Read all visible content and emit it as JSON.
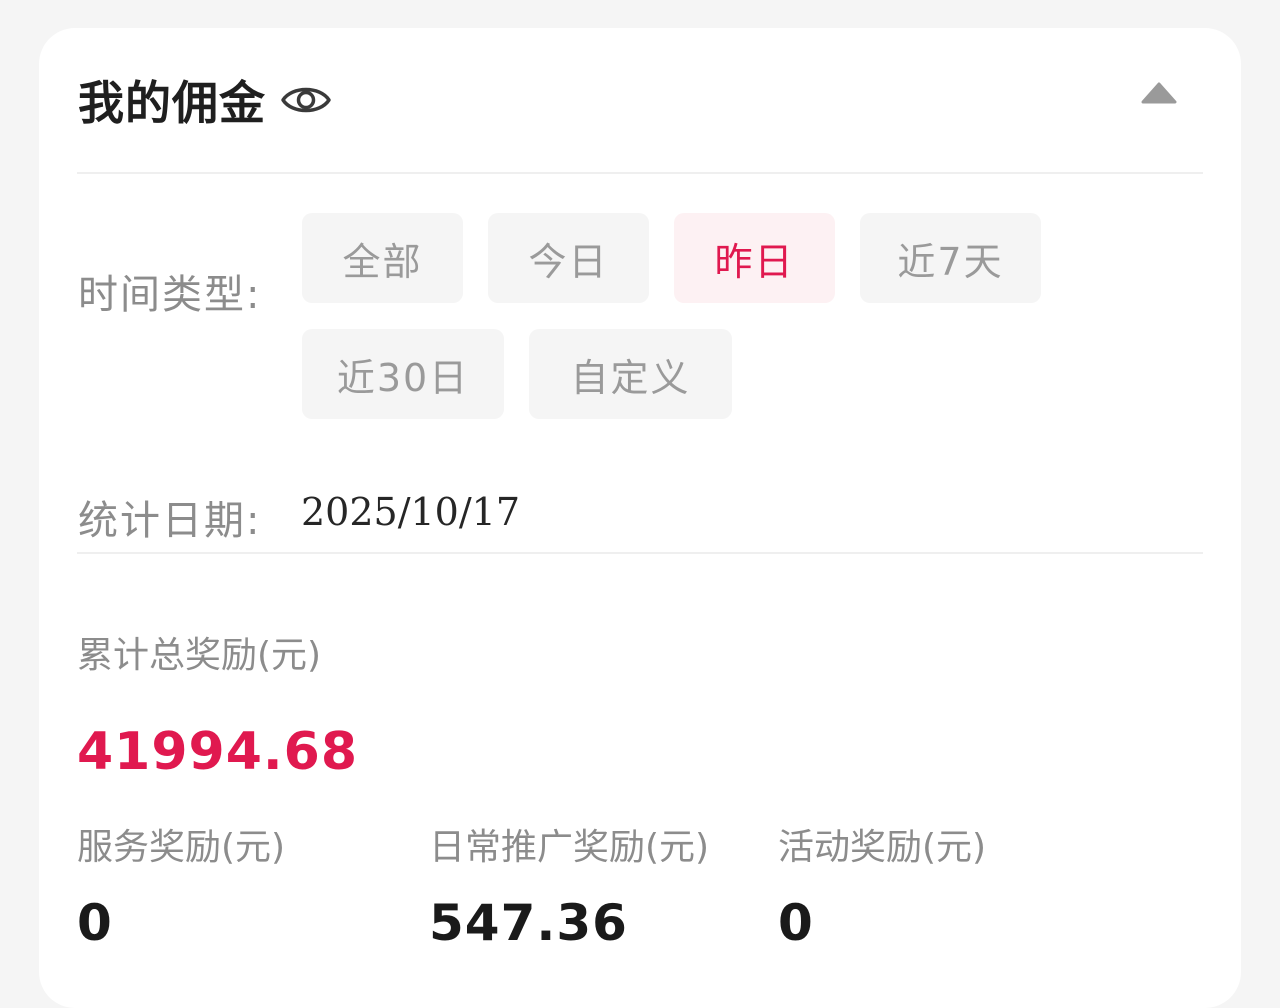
{
  "header": {
    "title": "我的佣金",
    "eye_icon": "eye-icon",
    "collapse_icon": "triangle-up-icon"
  },
  "filter": {
    "time_type_label": "时间类型:",
    "options": [
      "全部",
      "今日",
      "昨日",
      "近7天",
      "近30日",
      "自定义"
    ],
    "selected": "昨日"
  },
  "stat_date": {
    "label": "统计日期:",
    "value": "2025/10/17"
  },
  "total": {
    "label": "累计总奖励(元)",
    "value": "41994.68"
  },
  "breakdown": [
    {
      "label": "服务奖励(元)",
      "value": "0"
    },
    {
      "label": "日常推广奖励(元)",
      "value": "547.36"
    },
    {
      "label": "活动奖励(元)",
      "value": "0"
    }
  ],
  "colors": {
    "accent": "#e0194f",
    "active_bg": "#fdf1f3",
    "muted_text": "#8c8c8c",
    "button_bg": "#f5f5f5"
  }
}
